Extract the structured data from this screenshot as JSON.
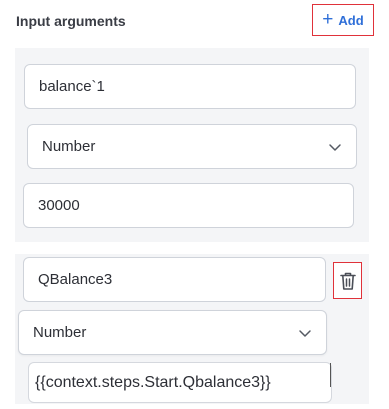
{
  "header": {
    "title": "Input arguments",
    "add_label": "Add",
    "add_icon": "plus-icon"
  },
  "arguments": [
    {
      "name": "balance`1",
      "type": "Number",
      "value": "30000"
    },
    {
      "name": "QBalance3",
      "type": "Number",
      "value": "{{context.steps.Start.Qbalance3}}"
    }
  ],
  "icons": {
    "delete": "trash-icon",
    "dropdown": "chevron-down-icon"
  },
  "colors": {
    "accent": "#2f6fd8",
    "highlight_border": "#e0323a",
    "panel_bg": "#f4f5f7"
  }
}
